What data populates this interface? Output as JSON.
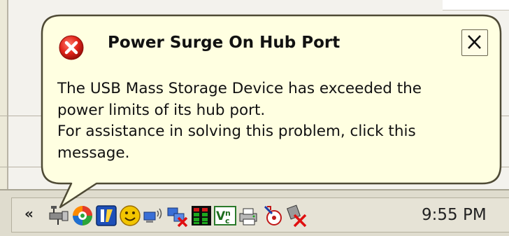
{
  "balloon": {
    "title": "Power Surge On Hub Port",
    "message_lines": [
      "The USB Mass Storage Device has exceeded the",
      "power limits of its hub port.",
      "For assistance in solving this problem, click this",
      "message."
    ],
    "close_label": "×",
    "background_color": "#ffffe1",
    "border_color": "#4e4a35",
    "error_icon": "error-x-icon"
  },
  "taskbar": {
    "tray_chevron": "«",
    "clock": "9:55 PM",
    "tray_icons": [
      "usb-safely-remove-icon",
      "colorful-swirl-icon",
      "blue-app-icon",
      "yellow-smiley-icon",
      "wireless-network-icon",
      "network-disconnected-icon",
      "audio-meter-icon",
      "vnc-icon",
      "printer-icon",
      "bluetooth-device-icon",
      "remove-hardware-icon"
    ]
  }
}
